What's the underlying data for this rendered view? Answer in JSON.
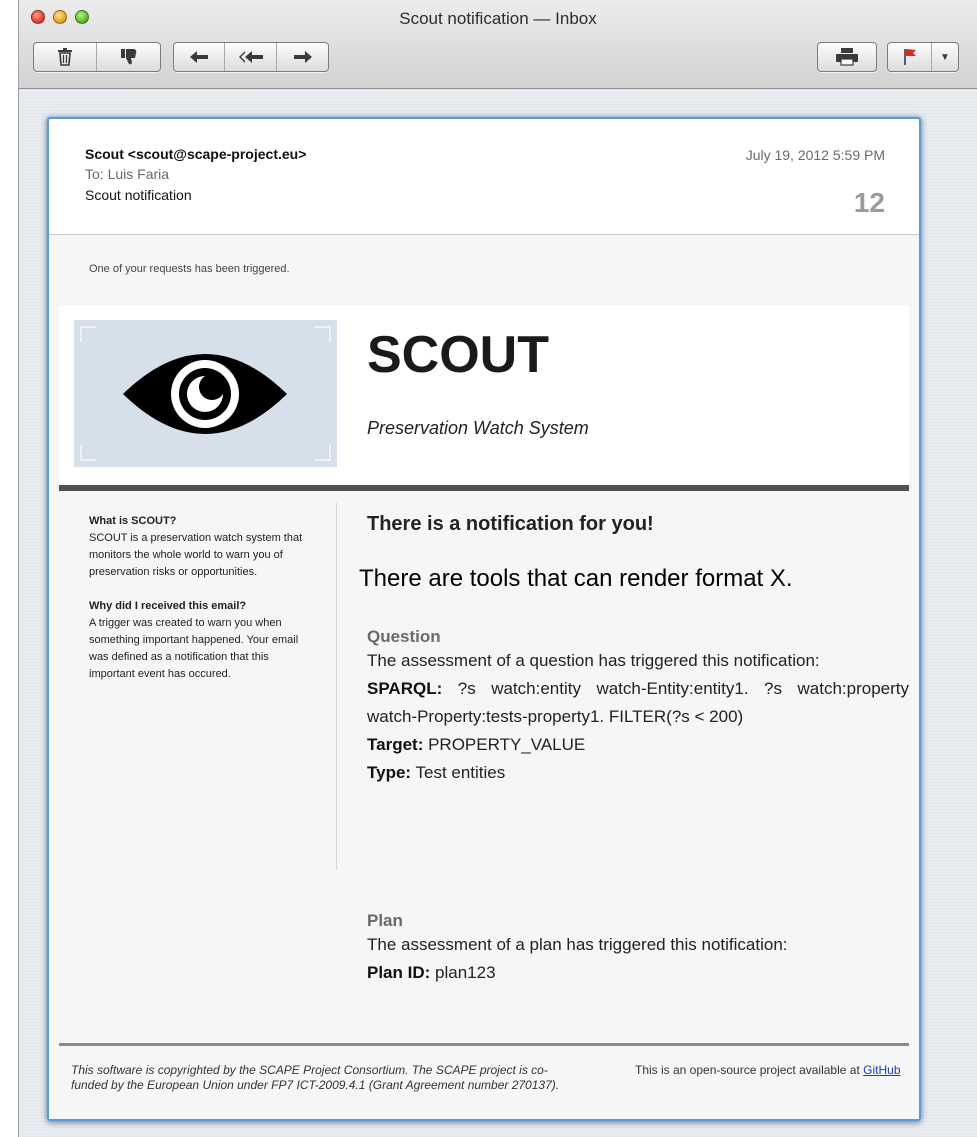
{
  "window": {
    "title": "Scout notification — Inbox"
  },
  "toolbar": {
    "delete_icon": "trash-icon",
    "junk_icon": "thumbs-down-icon",
    "reply_icon": "reply-arrow",
    "reply_all_icon": "reply-all-arrow",
    "forward_icon": "forward-arrow",
    "print_icon": "printer-icon",
    "flag_icon": "flag-icon"
  },
  "message": {
    "from": "Scout <scout@scape-project.eu>",
    "to": "To:  Luis Faria",
    "subject": "Scout notification",
    "date": "July 19, 2012 5:59 PM",
    "size": "12"
  },
  "body": {
    "triggered": "One of your requests has been triggered.",
    "brand": "SCOUT",
    "tagline": "Preservation Watch System",
    "sidebar": {
      "what_heading": "What is SCOUT?",
      "what_text": "SCOUT is a preservation watch system that monitors the whole world to warn you of preservation risks or opportunities.",
      "why_heading": "Why did I received this email?",
      "why_text": "A trigger was created to warn you when something important happened. Your email was defined as a notification that this important event has occured."
    },
    "notification_title": "There is a notification for you!",
    "overlay_text": "There are tools that can render format X.",
    "question": {
      "heading": "Question",
      "text": "The assessment of a question has triggered this notification:",
      "sparql_label": "SPARQL:",
      "sparql_value": "?s watch:entity watch-Entity:entity1. ?s watch:property watch-Property:tests-property1. FILTER(?s < 200)",
      "target_label": "Target:",
      "target_value": "PROPERTY_VALUE",
      "type_label": "Type:",
      "type_value": "Test entities"
    },
    "plan": {
      "heading": "Plan",
      "text": "The assessment of a plan has triggered this notification:",
      "id_label": "Plan ID:",
      "id_value": "plan123"
    }
  },
  "footer": {
    "copyright": "This software is copyrighted by the SCAPE Project Consortium. The SCAPE project is co-funded by the European Union under FP7 ICT-2009.4.1 (Grant Agreement number 270137).",
    "open_source_text": "This is an open-source project available at",
    "github_link": "GitHub"
  }
}
